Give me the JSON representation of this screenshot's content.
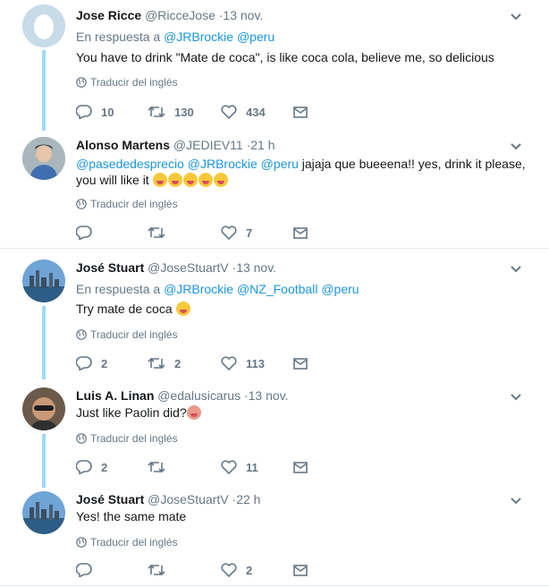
{
  "ui": {
    "translate_label": "Traducir del inglés",
    "replying_prefix": "En respuesta a"
  },
  "tweets": [
    {
      "name": "Jose Ricce",
      "handle": "@RicceJose",
      "time": "13 nov.",
      "reply_to": [
        "@JRBrockie",
        "@peru"
      ],
      "text": "You have to drink  \"Mate de coca\",  is like coca cola, believe me, so delicious",
      "replies": "10",
      "retweets": "130",
      "likes": "434"
    },
    {
      "name": "Alonso Martens",
      "handle": "@JEDIEV11",
      "time": "21 h",
      "mentions": [
        "@pasededesprecio",
        "@JRBrockie",
        "@peru"
      ],
      "text_after_mentions": " jajaja que bueeena!! yes, drink it please,",
      "text_line2": "you will like it",
      "replies": "",
      "retweets": "",
      "likes": "7"
    },
    {
      "name": "José Stuart",
      "handle": "@JoseStuartV",
      "time": "13 nov.",
      "reply_to": [
        "@JRBrockie",
        "@NZ_Football",
        "@peru"
      ],
      "text": "Try mate de coca",
      "replies": "2",
      "retweets": "2",
      "likes": "113"
    },
    {
      "name": "Luis A. Linan",
      "handle": "@edalusicarus",
      "time": "13 nov.",
      "text": "Just like Paolin did?",
      "replies": "2",
      "retweets": "",
      "likes": "11"
    },
    {
      "name": "José Stuart",
      "handle": "@JoseStuartV",
      "time": "22 h",
      "text": "Yes! the same mate",
      "replies": "",
      "retweets": "",
      "likes": "2"
    }
  ]
}
